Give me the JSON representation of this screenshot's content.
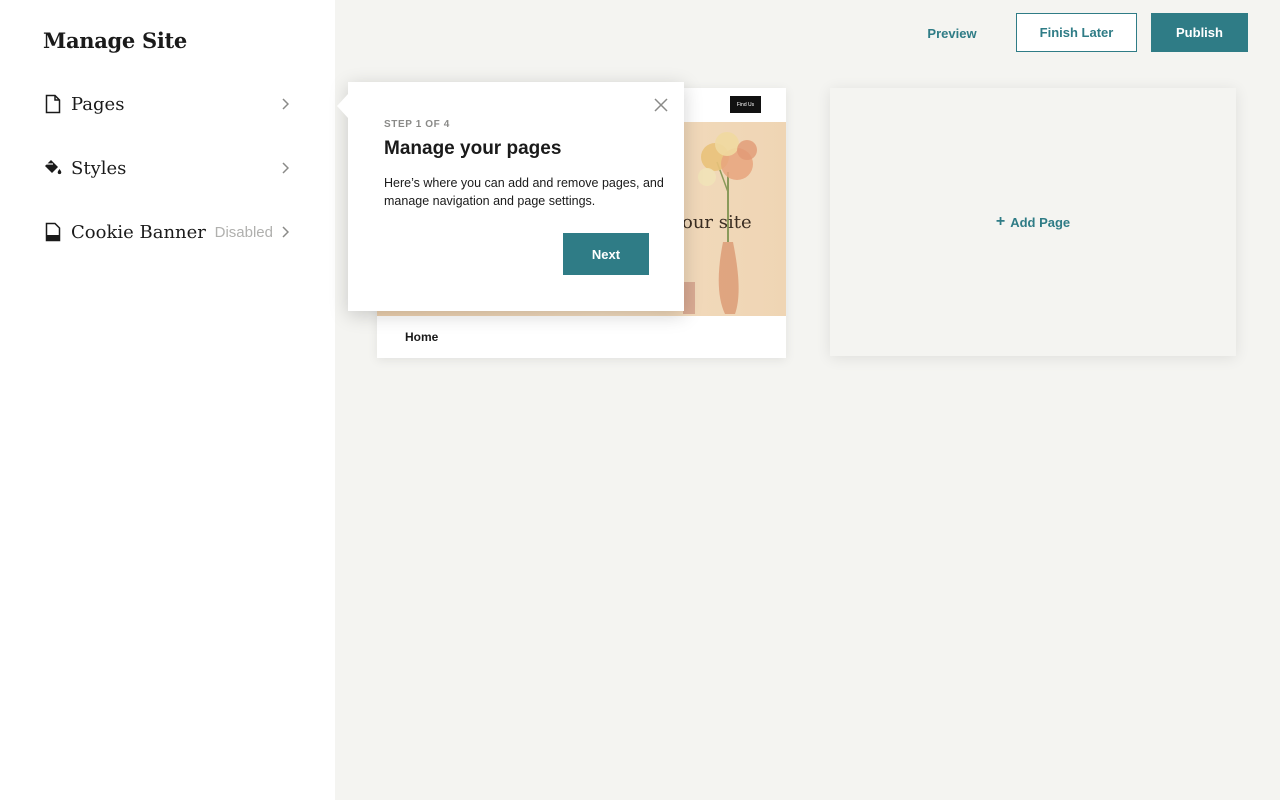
{
  "sidebar": {
    "title": "Manage Site",
    "items": [
      {
        "label": "Pages",
        "icon": "document-icon",
        "status": ""
      },
      {
        "label": "Styles",
        "icon": "paint-bucket-icon",
        "status": ""
      },
      {
        "label": "Cookie Banner",
        "icon": "cookie-banner-icon",
        "status": "Disabled"
      }
    ]
  },
  "toolbar": {
    "preview_label": "Preview",
    "finish_label": "Finish Later",
    "publish_label": "Publish"
  },
  "page_card": {
    "thumb_button": "Find Us",
    "thumb_hero_text": "our site",
    "name": "Home"
  },
  "add_page": {
    "label": "Add Page"
  },
  "popover": {
    "step": "STEP 1 OF 4",
    "title": "Manage your pages",
    "body": "Here’s where you can add and remove pages, and manage navigation and page settings.",
    "next_label": "Next"
  },
  "colors": {
    "accent": "#2f7c86",
    "canvas": "#f4f4f1",
    "sidebar": "#ffffff"
  }
}
